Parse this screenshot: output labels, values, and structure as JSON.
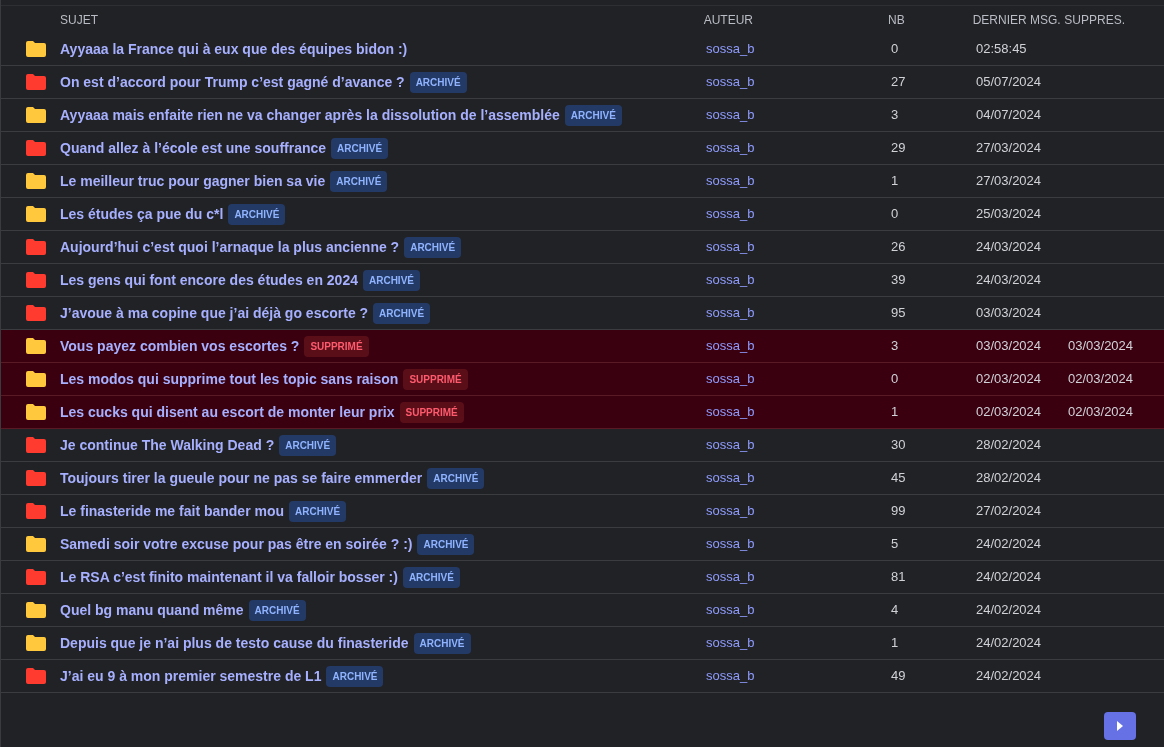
{
  "table": {
    "columns": [
      "SUJET",
      "AUTEUR",
      "NB",
      "DERNIER MSG.",
      "SUPPRES."
    ],
    "rows": [
      {
        "color": "#ffc83d",
        "subject": "Ayyaaa la France qui à eux que des équipes bidon :)",
        "author": "sossa_b",
        "count": "0",
        "last": "02:58:45",
        "deleted": false
      },
      {
        "color": "#ff3b30",
        "subject": "On est d’accord pour Trump c’est gagné d’avance ?",
        "badge": {
          "kind": "archived",
          "text": "ARCHIVÉ"
        },
        "author": "sossa_b",
        "count": "27",
        "last": "05/07/2024",
        "deleted": false
      },
      {
        "color": "#ffc83d",
        "subject": "Ayyaaa mais enfaite rien ne va changer après la dissolution de l’assemblée",
        "badge": {
          "kind": "archived",
          "text": "ARCHIVÉ"
        },
        "author": "sossa_b",
        "count": "3",
        "last": "04/07/2024",
        "deleted": false
      },
      {
        "color": "#ff3b30",
        "subject": "Quand allez à l’école est une souffrance",
        "badge": {
          "kind": "archived",
          "text": "ARCHIVÉ"
        },
        "author": "sossa_b",
        "count": "29",
        "last": "27/03/2024",
        "deleted": false
      },
      {
        "color": "#ffc83d",
        "subject": "Le meilleur truc pour gagner bien sa vie",
        "badge": {
          "kind": "archived",
          "text": "ARCHIVÉ"
        },
        "author": "sossa_b",
        "count": "1",
        "last": "27/03/2024",
        "deleted": false
      },
      {
        "color": "#ffc83d",
        "subject": "Les études ça pue du c*l",
        "badge": {
          "kind": "archived",
          "text": "ARCHIVÉ"
        },
        "author": "sossa_b",
        "count": "0",
        "last": "25/03/2024",
        "deleted": false
      },
      {
        "color": "#ff3b30",
        "subject": "Aujourd’hui c’est quoi l’arnaque la plus ancienne ?",
        "badge": {
          "kind": "archived",
          "text": "ARCHIVÉ"
        },
        "author": "sossa_b",
        "count": "26",
        "last": "24/03/2024",
        "deleted": false
      },
      {
        "color": "#ff3b30",
        "subject": "Les gens qui font encore des études en 2024",
        "badge": {
          "kind": "archived",
          "text": "ARCHIVÉ"
        },
        "author": "sossa_b",
        "count": "39",
        "last": "24/03/2024",
        "deleted": false
      },
      {
        "color": "#ff3b30",
        "subject": "J’avoue à ma copine que j’ai déjà go escorte ?",
        "badge": {
          "kind": "archived",
          "text": "ARCHIVÉ"
        },
        "author": "sossa_b",
        "count": "95",
        "last": "03/03/2024",
        "deleted": false
      },
      {
        "color": "#ffc83d",
        "subject": "Vous payez combien vos escortes ?",
        "badge": {
          "kind": "deleted",
          "text": "SUPPRIMÉ"
        },
        "author": "sossa_b",
        "count": "3",
        "last": "03/03/2024",
        "deleted_on": "03/03/2024",
        "deleted": true
      },
      {
        "color": "#ffc83d",
        "subject": "Les modos qui supprime tout les topic sans raison",
        "badge": {
          "kind": "deleted",
          "text": "SUPPRIMÉ"
        },
        "author": "sossa_b",
        "count": "0",
        "last": "02/03/2024",
        "deleted_on": "02/03/2024",
        "deleted": true
      },
      {
        "color": "#ffc83d",
        "subject": "Les cucks qui disent au escort de monter leur prix",
        "badge": {
          "kind": "deleted",
          "text": "SUPPRIMÉ"
        },
        "author": "sossa_b",
        "count": "1",
        "last": "02/03/2024",
        "deleted_on": "02/03/2024",
        "deleted": true
      },
      {
        "color": "#ff3b30",
        "subject": "Je continue The Walking Dead ?",
        "badge": {
          "kind": "archived",
          "text": "ARCHIVÉ"
        },
        "author": "sossa_b",
        "count": "30",
        "last": "28/02/2024",
        "deleted": false
      },
      {
        "color": "#ff3b30",
        "subject": "Toujours tirer la gueule pour ne pas se faire emmerder",
        "badge": {
          "kind": "archived",
          "text": "ARCHIVÉ"
        },
        "author": "sossa_b",
        "count": "45",
        "last": "28/02/2024",
        "deleted": false
      },
      {
        "color": "#ff3b30",
        "subject": "Le finasteride me fait bander mou",
        "badge": {
          "kind": "archived",
          "text": "ARCHIVÉ"
        },
        "author": "sossa_b",
        "count": "99",
        "last": "27/02/2024",
        "deleted": false
      },
      {
        "color": "#ffc83d",
        "subject": "Samedi soir votre excuse pour pas être en soirée ? :)",
        "badge": {
          "kind": "archived",
          "text": "ARCHIVÉ"
        },
        "author": "sossa_b",
        "count": "5",
        "last": "24/02/2024",
        "deleted": false
      },
      {
        "color": "#ff3b30",
        "subject": "Le RSA c’est finito maintenant il va falloir bosser :)",
        "badge": {
          "kind": "archived",
          "text": "ARCHIVÉ"
        },
        "author": "sossa_b",
        "count": "81",
        "last": "24/02/2024",
        "deleted": false
      },
      {
        "color": "#ffc83d",
        "subject": "Quel bg manu quand même",
        "badge": {
          "kind": "archived",
          "text": "ARCHIVÉ"
        },
        "author": "sossa_b",
        "count": "4",
        "last": "24/02/2024",
        "deleted": false
      },
      {
        "color": "#ffc83d",
        "subject": "Depuis que je n’ai plus de testo cause du finasteride",
        "badge": {
          "kind": "archived",
          "text": "ARCHIVÉ"
        },
        "author": "sossa_b",
        "count": "1",
        "last": "24/02/2024",
        "deleted": false
      },
      {
        "color": "#ff3b30",
        "subject": "J’ai eu 9 à mon premier semestre de L1",
        "badge": {
          "kind": "archived",
          "text": "ARCHIVÉ"
        },
        "author": "sossa_b",
        "count": "49",
        "last": "24/02/2024",
        "deleted": false
      }
    ]
  },
  "pagination": {
    "next_disabled": false
  }
}
